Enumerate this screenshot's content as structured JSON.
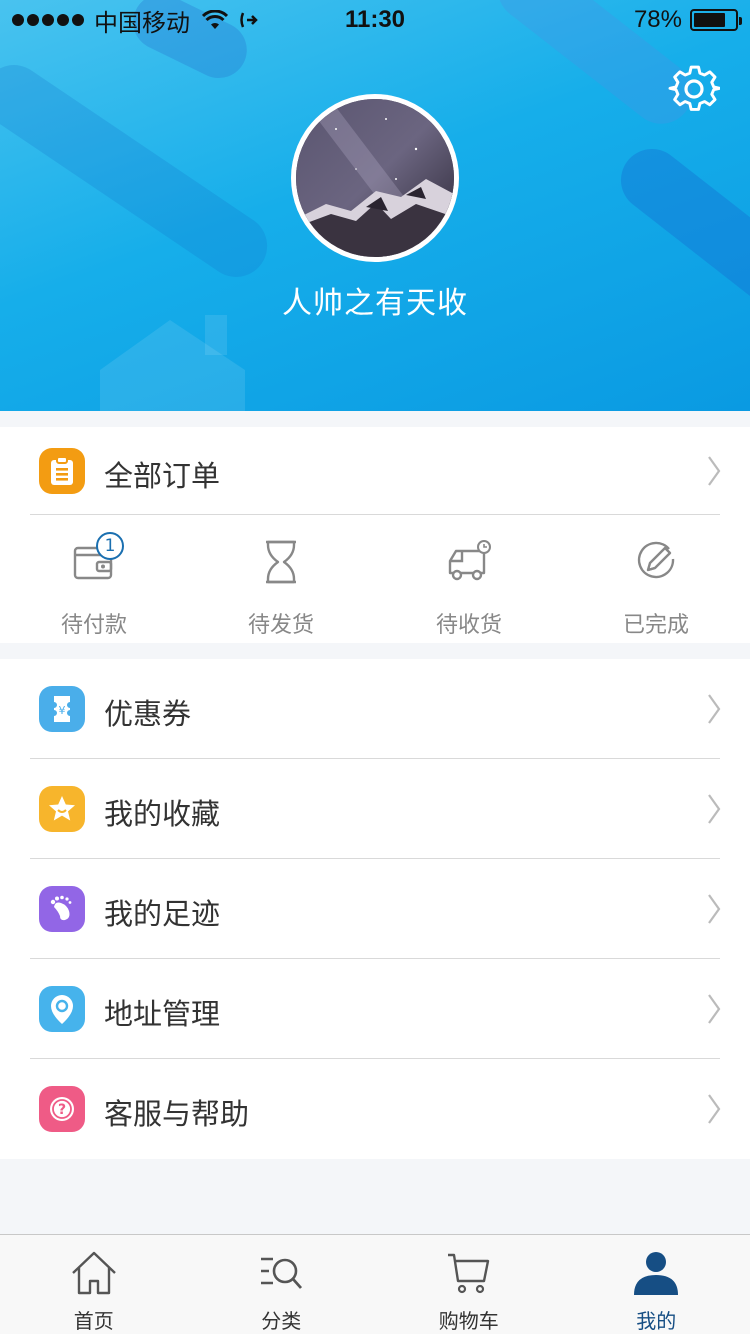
{
  "status_bar": {
    "carrier": "中国移动",
    "time": "11:30",
    "battery_percent": "78%",
    "battery_level": 0.78
  },
  "profile": {
    "username": "人帅之有天收"
  },
  "orders": {
    "all_orders_label": "全部订单",
    "statuses": [
      {
        "label": "待付款",
        "icon": "wallet-icon",
        "badge": "1"
      },
      {
        "label": "待发货",
        "icon": "hourglass-icon"
      },
      {
        "label": "待收货",
        "icon": "delivery-truck-icon"
      },
      {
        "label": "已完成",
        "icon": "completed-pen-icon"
      }
    ]
  },
  "menu": {
    "items": [
      {
        "label": "优惠券",
        "icon": "coupon-icon",
        "color": "#4aaeea"
      },
      {
        "label": "我的收藏",
        "icon": "star-icon",
        "color": "#f7b52c"
      },
      {
        "label": "我的足迹",
        "icon": "footprint-icon",
        "color": "#9266e6"
      },
      {
        "label": "地址管理",
        "icon": "location-pin-icon",
        "color": "#46b3ec"
      },
      {
        "label": "客服与帮助",
        "icon": "help-icon",
        "color": "#ef5b86"
      }
    ]
  },
  "tabbar": {
    "tabs": [
      {
        "label": "首页",
        "icon": "home-icon"
      },
      {
        "label": "分类",
        "icon": "category-search-icon"
      },
      {
        "label": "购物车",
        "icon": "cart-icon"
      },
      {
        "label": "我的",
        "icon": "user-icon",
        "active": true
      }
    ]
  },
  "colors": {
    "header_blue": "#16aeea",
    "orders_icon": "#f39c12",
    "active_tab": "#164e84"
  }
}
